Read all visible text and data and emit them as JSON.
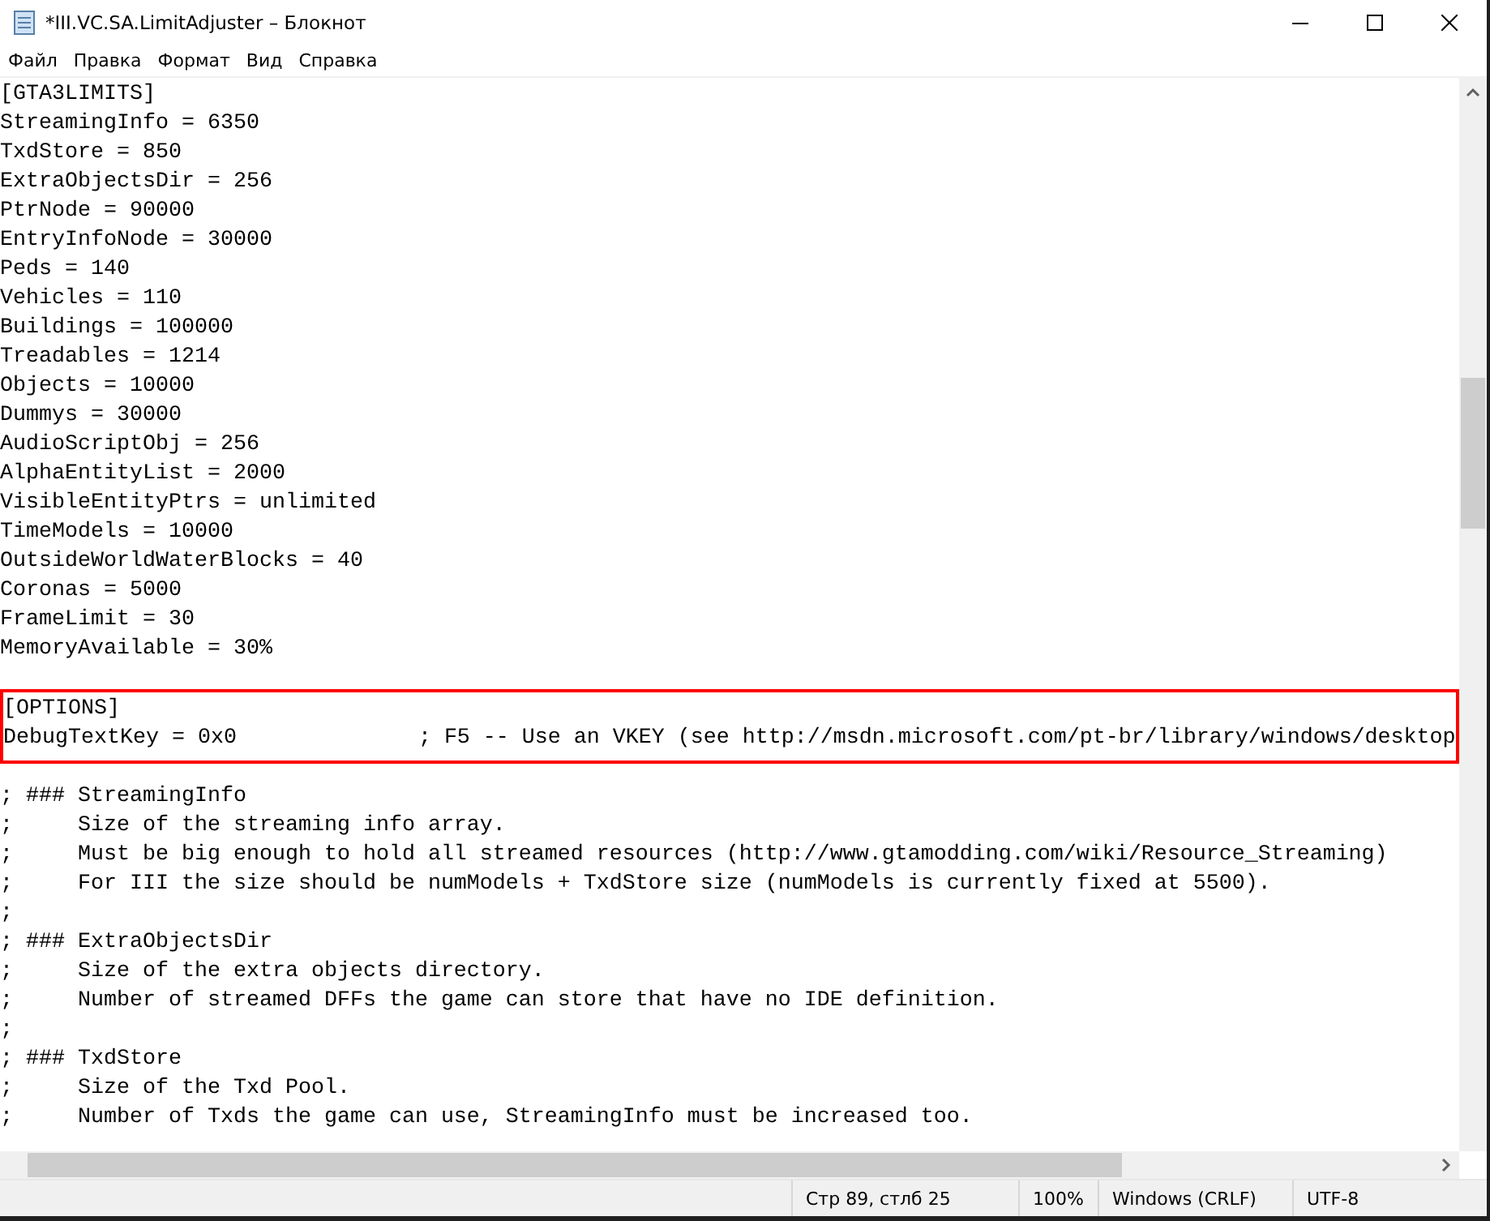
{
  "window": {
    "title": "*III.VC.SA.LimitAdjuster – Блокнот"
  },
  "menu": [
    "Файл",
    "Правка",
    "Формат",
    "Вид",
    "Справка"
  ],
  "editor": {
    "sections": [
      {
        "highlighted": false,
        "lines": [
          "[GTA3LIMITS]",
          "StreamingInfo = 6350",
          "TxdStore = 850",
          "ExtraObjectsDir = 256",
          "PtrNode = 90000",
          "EntryInfoNode = 30000",
          "Peds = 140",
          "Vehicles = 110",
          "Buildings = 100000",
          "Treadables = 1214",
          "Objects = 10000",
          "Dummys = 30000",
          "AudioScriptObj = 256",
          "AlphaEntityList = 2000",
          "VisibleEntityPtrs = unlimited",
          "TimeModels = 10000",
          "OutsideWorldWaterBlocks = 40",
          "Coronas = 5000",
          "FrameLimit = 30",
          "MemoryAvailable = 30%"
        ]
      },
      {
        "highlighted": true,
        "lines": [
          "[OPTIONS]",
          "DebugTextKey = 0x0              ; F5 -- Use an VKEY (see http://msdn.microsoft.com/pt-br/library/windows/desktop"
        ]
      },
      {
        "highlighted": false,
        "lines": [
          "; ### StreamingInfo",
          ";     Size of the streaming info array.",
          ";     Must be big enough to hold all streamed resources (http://www.gtamodding.com/wiki/Resource_Streaming)",
          ";     For III the size should be numModels + TxdStore size (numModels is currently fixed at 5500).",
          ";",
          "; ### ExtraObjectsDir",
          ";     Size of the extra objects directory.",
          ";     Number of streamed DFFs the game can store that have no IDE definition.",
          ";",
          "; ### TxdStore",
          ";     Size of the Txd Pool.",
          ";     Number of Txds the game can use, StreamingInfo must be increased too."
        ]
      }
    ]
  },
  "status_bar": [
    "Стр 89, стлб 25",
    "100%",
    "Windows (CRLF)",
    "UTF-8"
  ]
}
